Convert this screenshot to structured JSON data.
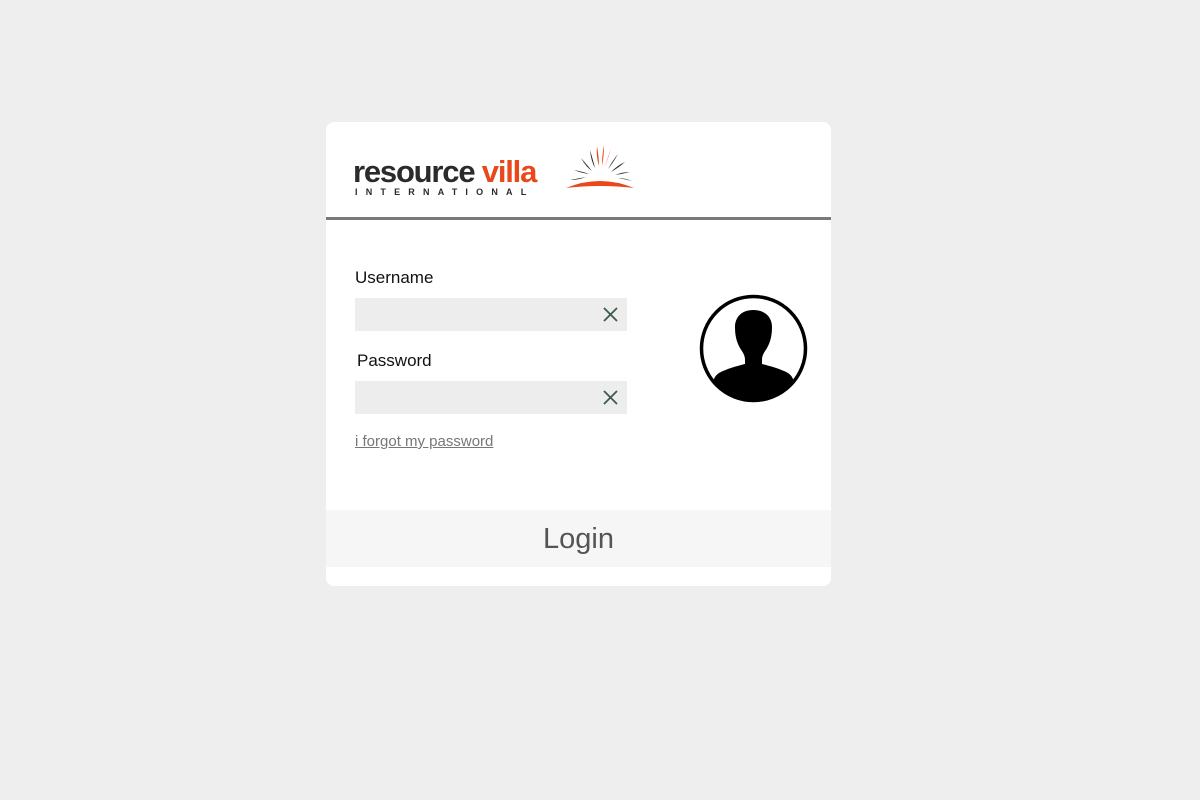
{
  "brand": {
    "word1": "resource",
    "word2": "villa",
    "subtitle": "INTERNATIONAL",
    "logo_icon": "sunburst-logo-mark",
    "color_dark": "#2b2b2b",
    "color_accent": "#e8481a"
  },
  "form": {
    "username_label": "Username",
    "username_value": "",
    "password_label": "Password",
    "password_value": "",
    "clear_icon": "close-icon",
    "forgot_link": "i forgot my password",
    "avatar_icon": "user-avatar-icon",
    "submit_label": "Login"
  },
  "colors": {
    "page_bg": "#eeeeee",
    "card_bg": "#ffffff",
    "divider": "#7a7a7a",
    "input_bg": "#ededed",
    "clear_icon": "#3d5a4a",
    "button_bg": "#f6f6f6"
  }
}
